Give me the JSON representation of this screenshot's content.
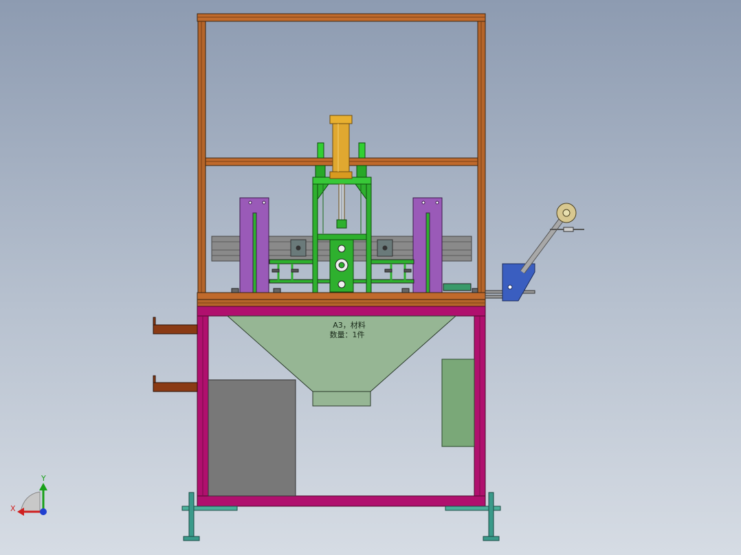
{
  "hopper_label": {
    "line1": "A3，材料",
    "line2": "数量：1件"
  },
  "triad": {
    "x_label": "X",
    "y_label": "Y"
  },
  "colors": {
    "frame_upper": "#b5652a",
    "frame_lower": "#b0106e",
    "hopper": "#96b694",
    "cylinder": "#e0a830",
    "guide_green": "#28c428",
    "side_plate": "#9a5ab8",
    "rail": "#8a8a8a",
    "gray_box": "#787878",
    "green_panel": "#7aa878",
    "feeder_blue": "#3a5ec0",
    "spool": "#d8c890",
    "leveling_foot": "#3a9a8a",
    "bracket_brown": "#8a3a14"
  }
}
